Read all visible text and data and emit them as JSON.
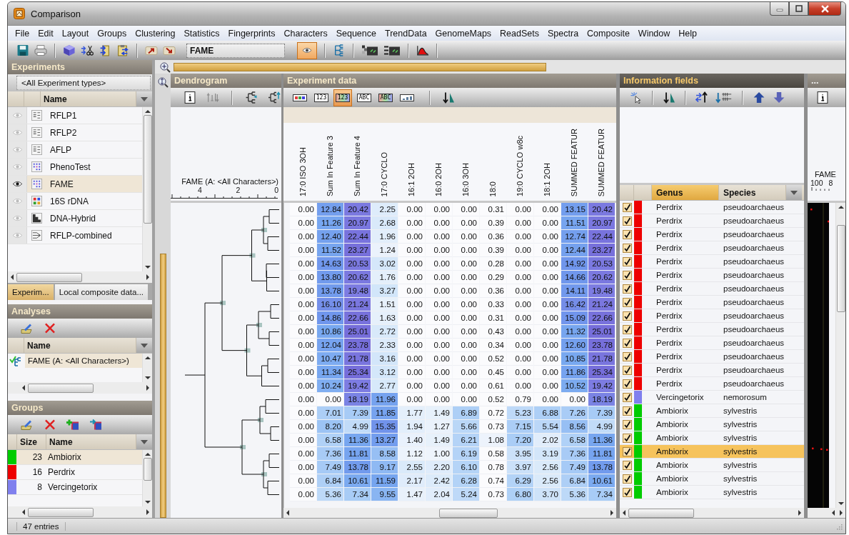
{
  "window": {
    "title": "Comparison"
  },
  "menu": [
    "File",
    "Edit",
    "Layout",
    "Groups",
    "Clustering",
    "Statistics",
    "Fingerprints",
    "Characters",
    "Sequence",
    "TrendData",
    "GenomeMaps",
    "ReadSets",
    "Spectra",
    "Composite",
    "Window",
    "Help"
  ],
  "toolbar": {
    "field": "FAME",
    "eye_toggle": {
      "on": true
    }
  },
  "experiments": {
    "title": "Experiments",
    "filter": "<All Experiment types>",
    "column": "Name",
    "items": [
      {
        "name": "RFLP1",
        "kind": "bands",
        "visible": false,
        "selected": false
      },
      {
        "name": "RFLP2",
        "kind": "bands",
        "visible": false,
        "selected": false
      },
      {
        "name": "AFLP",
        "kind": "bands",
        "visible": false,
        "selected": false
      },
      {
        "name": "PhenoTest",
        "kind": "grid",
        "visible": false,
        "selected": false
      },
      {
        "name": "FAME",
        "kind": "grid",
        "visible": true,
        "selected": true
      },
      {
        "name": "16S rDNA",
        "kind": "sequence",
        "visible": false,
        "selected": false
      },
      {
        "name": "DNA-Hybrid",
        "kind": "hybrid",
        "visible": false,
        "selected": false
      },
      {
        "name": "RFLP-combined",
        "kind": "combined",
        "visible": false,
        "selected": false
      }
    ],
    "tabs": [
      {
        "label": "Experim...",
        "selected": true
      },
      {
        "label": "Local composite data...",
        "selected": false
      }
    ]
  },
  "analyses": {
    "title": "Analyses",
    "column": "Name",
    "items": [
      {
        "name": "FAME (A: <All Characters>)",
        "selected": true
      }
    ]
  },
  "groups": {
    "title": "Groups",
    "columns": [
      "Size",
      "Name"
    ],
    "items": [
      {
        "size": "23",
        "name": "Ambiorix",
        "color": "#00cc00",
        "selected": true
      },
      {
        "size": "16",
        "name": "Perdrix",
        "color": "#ee0000",
        "selected": false
      },
      {
        "size": "8",
        "name": "Vercingetorix",
        "color": "#8080ee",
        "selected": false
      }
    ]
  },
  "dendrogram": {
    "title": "Dendrogram",
    "label": "FAME (A: <All Characters>)",
    "scale": [
      "4",
      "2",
      "0"
    ]
  },
  "experiment_data": {
    "title": "Experiment data",
    "view_modes": [
      {
        "kind": "swatch",
        "colored": true,
        "selected": false
      },
      {
        "kind": "label",
        "label": "123",
        "colored": false,
        "selected": false
      },
      {
        "kind": "label",
        "label": "123",
        "colored": true,
        "selected": true
      },
      {
        "kind": "label",
        "label": "ABC",
        "colored": false,
        "selected": false
      },
      {
        "kind": "label",
        "label": "ABC",
        "colored": true,
        "selected": false
      },
      {
        "kind": "bars",
        "colored": false,
        "selected": false
      }
    ],
    "columns": [
      "17:0 ISO 3OH",
      "Sum In Feature 3",
      "Sum In Feature 4",
      "17:0 CYCLO",
      "16:1 2OH",
      "16:0 2OH",
      "16:0 3OH",
      "18:0",
      "19:0 CYCLO w8c",
      "18:1 2OH",
      "SUMMED FEATUR",
      "SUMMED FEATUR"
    ],
    "rows": [
      [
        "0.00",
        "12.84",
        "20.42",
        "2.25",
        "0.00",
        "0.00",
        "0.00",
        "0.31",
        "0.00",
        "0.00",
        "13.15",
        "20.42"
      ],
      [
        "0.00",
        "11.26",
        "20.97",
        "2.68",
        "0.00",
        "0.00",
        "0.00",
        "0.39",
        "0.00",
        "0.00",
        "11.51",
        "20.97"
      ],
      [
        "0.00",
        "12.40",
        "22.44",
        "1.96",
        "0.00",
        "0.00",
        "0.00",
        "0.36",
        "0.00",
        "0.00",
        "12.74",
        "22.44"
      ],
      [
        "0.00",
        "11.52",
        "23.27",
        "1.24",
        "0.00",
        "0.00",
        "0.00",
        "0.39",
        "0.00",
        "0.00",
        "12.44",
        "23.27"
      ],
      [
        "0.00",
        "14.63",
        "20.53",
        "3.02",
        "0.00",
        "0.00",
        "0.00",
        "0.28",
        "0.00",
        "0.00",
        "14.92",
        "20.53"
      ],
      [
        "0.00",
        "13.80",
        "20.62",
        "1.76",
        "0.00",
        "0.00",
        "0.00",
        "0.29",
        "0.00",
        "0.00",
        "14.66",
        "20.62"
      ],
      [
        "0.00",
        "13.78",
        "19.48",
        "3.27",
        "0.00",
        "0.00",
        "0.00",
        "0.36",
        "0.00",
        "0.00",
        "14.11",
        "19.48"
      ],
      [
        "0.00",
        "16.10",
        "21.24",
        "1.51",
        "0.00",
        "0.00",
        "0.00",
        "0.33",
        "0.00",
        "0.00",
        "16.42",
        "21.24"
      ],
      [
        "0.00",
        "14.86",
        "22.66",
        "1.63",
        "0.00",
        "0.00",
        "0.00",
        "0.31",
        "0.00",
        "0.00",
        "15.09",
        "22.66"
      ],
      [
        "0.00",
        "10.86",
        "25.01",
        "2.72",
        "0.00",
        "0.00",
        "0.00",
        "0.43",
        "0.00",
        "0.00",
        "11.32",
        "25.01"
      ],
      [
        "0.00",
        "12.04",
        "23.78",
        "2.33",
        "0.00",
        "0.00",
        "0.00",
        "0.34",
        "0.00",
        "0.00",
        "12.60",
        "23.78"
      ],
      [
        "0.00",
        "10.47",
        "21.78",
        "3.16",
        "0.00",
        "0.00",
        "0.00",
        "0.52",
        "0.00",
        "0.00",
        "10.85",
        "21.78"
      ],
      [
        "0.00",
        "11.34",
        "25.34",
        "3.12",
        "0.00",
        "0.00",
        "0.00",
        "0.45",
        "0.00",
        "0.00",
        "11.86",
        "25.34"
      ],
      [
        "0.00",
        "10.24",
        "19.42",
        "2.77",
        "0.00",
        "0.00",
        "0.00",
        "0.61",
        "0.00",
        "0.00",
        "10.52",
        "19.42"
      ],
      [
        "0.00",
        "0.00",
        "18.19",
        "11.96",
        "0.00",
        "0.00",
        "0.00",
        "0.52",
        "0.79",
        "0.00",
        "0.00",
        "18.19"
      ],
      [
        "0.00",
        "7.01",
        "7.39",
        "11.85",
        "1.77",
        "1.49",
        "6.89",
        "0.72",
        "5.23",
        "6.88",
        "7.26",
        "7.39"
      ],
      [
        "0.00",
        "8.20",
        "4.99",
        "15.35",
        "1.94",
        "1.27",
        "5.66",
        "0.73",
        "7.15",
        "5.54",
        "8.56",
        "4.99"
      ],
      [
        "0.00",
        "6.58",
        "11.36",
        "13.27",
        "1.40",
        "1.49",
        "6.21",
        "1.08",
        "7.20",
        "2.02",
        "6.58",
        "11.36"
      ],
      [
        "0.00",
        "7.36",
        "11.81",
        "8.58",
        "1.12",
        "1.00",
        "6.19",
        "0.58",
        "3.95",
        "3.19",
        "7.36",
        "11.81"
      ],
      [
        "0.00",
        "7.49",
        "13.78",
        "9.17",
        "2.55",
        "2.20",
        "6.10",
        "0.78",
        "3.97",
        "2.56",
        "7.49",
        "13.78"
      ],
      [
        "0.00",
        "6.84",
        "10.61",
        "11.59",
        "2.17",
        "2.42",
        "6.28",
        "0.74",
        "6.29",
        "2.56",
        "6.84",
        "10.61"
      ],
      [
        "0.00",
        "5.36",
        "7.34",
        "9.55",
        "1.47",
        "2.04",
        "5.24",
        "0.73",
        "6.80",
        "3.70",
        "5.36",
        "7.34"
      ]
    ]
  },
  "information_fields": {
    "title": "Information fields",
    "columns": [
      {
        "label": "Genus",
        "sorted": true
      },
      {
        "label": "Species",
        "sorted": false
      }
    ],
    "rows": [
      {
        "checked": true,
        "color": "#ee0000",
        "genus": "Perdrix",
        "species": "pseudoarchaeus",
        "selected": false
      },
      {
        "checked": true,
        "color": "#ee0000",
        "genus": "Perdrix",
        "species": "pseudoarchaeus",
        "selected": false
      },
      {
        "checked": true,
        "color": "#ee0000",
        "genus": "Perdrix",
        "species": "pseudoarchaeus",
        "selected": false
      },
      {
        "checked": true,
        "color": "#ee0000",
        "genus": "Perdrix",
        "species": "pseudoarchaeus",
        "selected": false
      },
      {
        "checked": true,
        "color": "#ee0000",
        "genus": "Perdrix",
        "species": "pseudoarchaeus",
        "selected": false
      },
      {
        "checked": true,
        "color": "#ee0000",
        "genus": "Perdrix",
        "species": "pseudoarchaeus",
        "selected": false
      },
      {
        "checked": true,
        "color": "#ee0000",
        "genus": "Perdrix",
        "species": "pseudoarchaeus",
        "selected": false
      },
      {
        "checked": true,
        "color": "#ee0000",
        "genus": "Perdrix",
        "species": "pseudoarchaeus",
        "selected": false
      },
      {
        "checked": true,
        "color": "#ee0000",
        "genus": "Perdrix",
        "species": "pseudoarchaeus",
        "selected": false
      },
      {
        "checked": true,
        "color": "#ee0000",
        "genus": "Perdrix",
        "species": "pseudoarchaeus",
        "selected": false
      },
      {
        "checked": true,
        "color": "#ee0000",
        "genus": "Perdrix",
        "species": "pseudoarchaeus",
        "selected": false
      },
      {
        "checked": true,
        "color": "#ee0000",
        "genus": "Perdrix",
        "species": "pseudoarchaeus",
        "selected": false
      },
      {
        "checked": true,
        "color": "#ee0000",
        "genus": "Perdrix",
        "species": "pseudoarchaeus",
        "selected": false
      },
      {
        "checked": true,
        "color": "#ee0000",
        "genus": "Perdrix",
        "species": "pseudoarchaeus",
        "selected": false
      },
      {
        "checked": true,
        "color": "#8080ee",
        "genus": "Vercingetorix",
        "species": "nemorosum",
        "selected": false
      },
      {
        "checked": true,
        "color": "#00cc00",
        "genus": "Ambiorix",
        "species": "sylvestris",
        "selected": false
      },
      {
        "checked": true,
        "color": "#00cc00",
        "genus": "Ambiorix",
        "species": "sylvestris",
        "selected": false
      },
      {
        "checked": true,
        "color": "#00cc00",
        "genus": "Ambiorix",
        "species": "sylvestris",
        "selected": false
      },
      {
        "checked": true,
        "color": "#00cc00",
        "genus": "Ambiorix",
        "species": "sylvestris",
        "selected": true
      },
      {
        "checked": true,
        "color": "#00cc00",
        "genus": "Ambiorix",
        "species": "sylvestris",
        "selected": false
      },
      {
        "checked": true,
        "color": "#00cc00",
        "genus": "Ambiorix",
        "species": "sylvestris",
        "selected": false
      },
      {
        "checked": true,
        "color": "#00cc00",
        "genus": "Ambiorix",
        "species": "sylvestris",
        "selected": false
      }
    ]
  },
  "side_panel": {
    "title": "...",
    "label": "FAME",
    "scale": [
      "100",
      "8"
    ]
  },
  "status_bar": {
    "text": "47 entries"
  }
}
